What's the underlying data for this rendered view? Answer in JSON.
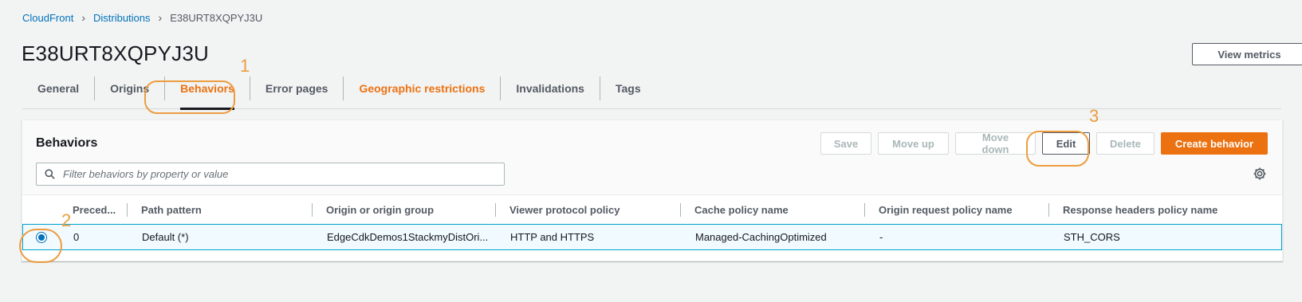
{
  "breadcrumb": {
    "items": [
      "CloudFront",
      "Distributions"
    ],
    "current": "E38URT8XQPYJ3U"
  },
  "page": {
    "title": "E38URT8XQPYJ3U",
    "view_metrics": "View metrics"
  },
  "tabs": [
    {
      "label": "General"
    },
    {
      "label": "Origins"
    },
    {
      "label": "Behaviors"
    },
    {
      "label": "Error pages"
    },
    {
      "label": "Geographic restrictions"
    },
    {
      "label": "Invalidations"
    },
    {
      "label": "Tags"
    }
  ],
  "behaviors": {
    "title": "Behaviors",
    "buttons": {
      "save": "Save",
      "move_up": "Move up",
      "move_down": "Move down",
      "edit": "Edit",
      "delete": "Delete",
      "create": "Create behavior"
    },
    "filter_placeholder": "Filter behaviors by property or value",
    "columns": [
      "Preced...",
      "Path pattern",
      "Origin or origin group",
      "Viewer protocol policy",
      "Cache policy name",
      "Origin request policy name",
      "Response headers policy name"
    ],
    "rows": [
      {
        "selected": true,
        "precedence": "0",
        "path_pattern": "Default (*)",
        "origin": "EdgeCdkDemos1StackmyDistOri...",
        "viewer_protocol": "HTTP and HTTPS",
        "cache_policy": "Managed-CachingOptimized",
        "origin_request_policy": "-",
        "response_headers_policy": "STH_CORS"
      }
    ]
  },
  "annotations": [
    "1",
    "2",
    "3"
  ],
  "colors": {
    "accent": "#ec7211",
    "link": "#0073bb",
    "annotation": "#ec9d40"
  }
}
